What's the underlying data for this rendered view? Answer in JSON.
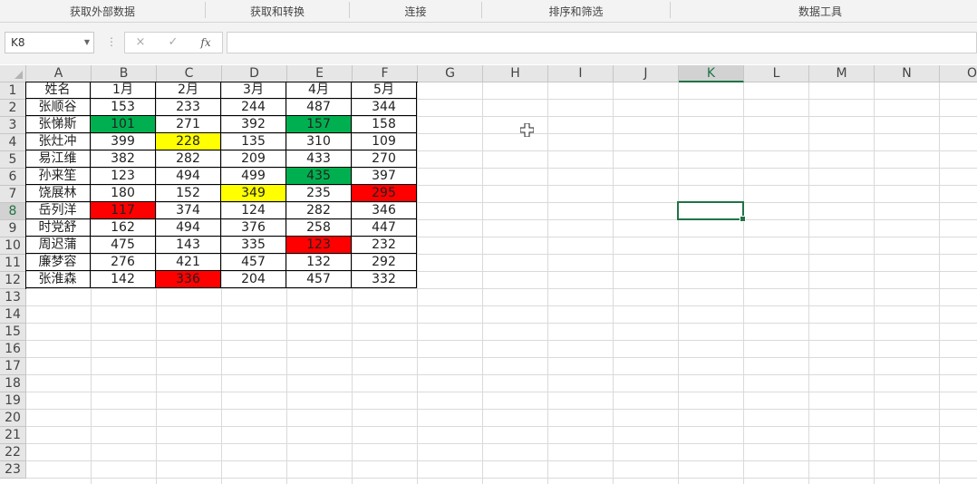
{
  "ribbon": {
    "groups": [
      "获取外部数据",
      "获取和转换",
      "连接",
      "排序和筛选",
      "数据工具"
    ]
  },
  "formula_bar": {
    "name_box": "K8",
    "formula": "",
    "cancel_icon": "×",
    "enter_icon": "✓",
    "fx_label": "fx"
  },
  "sheet": {
    "columns": [
      "A",
      "B",
      "C",
      "D",
      "E",
      "F",
      "G",
      "H",
      "I",
      "J",
      "K",
      "L",
      "M",
      "N",
      "O"
    ],
    "rows": [
      "1",
      "2",
      "3",
      "4",
      "5",
      "6",
      "7",
      "8",
      "9",
      "10",
      "11",
      "12",
      "13",
      "14",
      "15",
      "16",
      "17",
      "18",
      "19",
      "20",
      "21",
      "22",
      "23"
    ],
    "selected_cell": "K8",
    "selected_column": "K",
    "selected_row": "8",
    "colors": {
      "green": "#00b050",
      "yellow": "#ffff00",
      "red": "#ff0000",
      "accent": "#217346"
    },
    "table": [
      [
        "姓名",
        "1月",
        "2月",
        "3月",
        "4月",
        "5月"
      ],
      [
        "张顺谷",
        "153",
        "233",
        "244",
        "487",
        "344"
      ],
      [
        "张悌斯",
        "101",
        "271",
        "392",
        "157",
        "158"
      ],
      [
        "张灶冲",
        "399",
        "228",
        "135",
        "310",
        "109"
      ],
      [
        "易江维",
        "382",
        "282",
        "209",
        "433",
        "270"
      ],
      [
        "孙来笙",
        "123",
        "494",
        "499",
        "435",
        "397"
      ],
      [
        "饶展林",
        "180",
        "152",
        "349",
        "235",
        "295"
      ],
      [
        "岳列洋",
        "117",
        "374",
        "124",
        "282",
        "346"
      ],
      [
        "时党舒",
        "162",
        "494",
        "376",
        "258",
        "447"
      ],
      [
        "周迟蒲",
        "475",
        "143",
        "335",
        "123",
        "232"
      ],
      [
        "廉梦容",
        "276",
        "421",
        "457",
        "132",
        "292"
      ],
      [
        "张淮森",
        "142",
        "336",
        "204",
        "457",
        "332"
      ]
    ],
    "highlights": [
      {
        "row": 2,
        "col": 1,
        "color": "green"
      },
      {
        "row": 2,
        "col": 4,
        "color": "green"
      },
      {
        "row": 3,
        "col": 2,
        "color": "yellow"
      },
      {
        "row": 5,
        "col": 4,
        "color": "green"
      },
      {
        "row": 6,
        "col": 3,
        "color": "yellow"
      },
      {
        "row": 6,
        "col": 5,
        "color": "red"
      },
      {
        "row": 7,
        "col": 1,
        "color": "red"
      },
      {
        "row": 9,
        "col": 4,
        "color": "red"
      },
      {
        "row": 11,
        "col": 2,
        "color": "red"
      }
    ]
  }
}
